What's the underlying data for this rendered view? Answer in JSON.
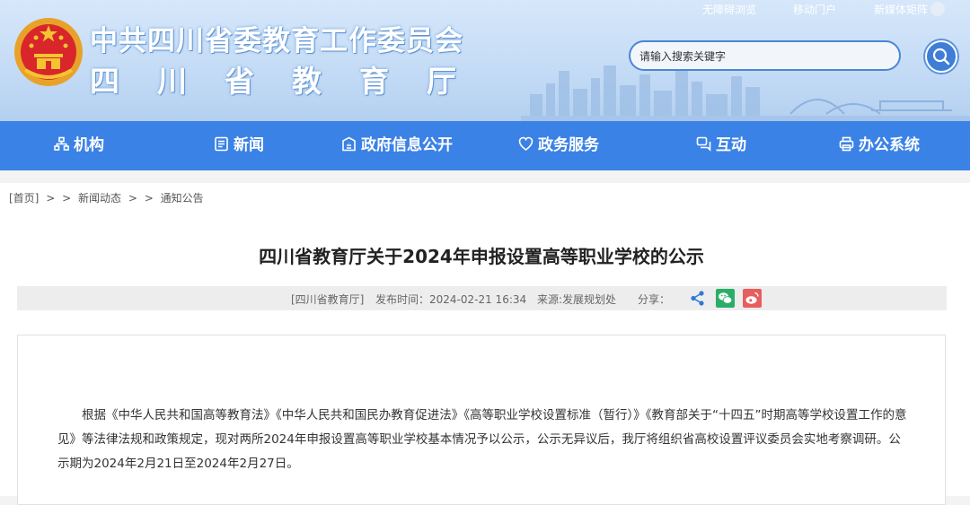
{
  "header": {
    "title_main": "中共四川省委教育工作委员会",
    "title_sub": "四川省教育厅",
    "top_links": [
      "无障碍浏览",
      "移动门户",
      "新媒体矩阵"
    ],
    "search_placeholder": "请输入搜索关键字"
  },
  "nav": {
    "items": [
      {
        "label": "机构",
        "icon": "org-icon"
      },
      {
        "label": "新闻",
        "icon": "news-icon"
      },
      {
        "label": "政府信息公开",
        "icon": "info-icon"
      },
      {
        "label": "政务服务",
        "icon": "service-icon"
      },
      {
        "label": "互动",
        "icon": "chat-icon"
      },
      {
        "label": "办公系统",
        "icon": "printer-icon"
      }
    ]
  },
  "breadcrumb": [
    "[首页]",
    ">",
    ">",
    "新闻动态",
    ">",
    ">",
    "通知公告"
  ],
  "article": {
    "title": "四川省教育厅关于2024年申报设置高等职业学校的公示",
    "meta": {
      "source_tag": "[四川省教育厅]",
      "publish_time": "发布时间：2024-02-21 16:34",
      "origin": "来源:发展规划处",
      "share_label": "分享："
    },
    "paragraph": "根据《中华人民共和国高等教育法》《中华人民共和国民办教育促进法》《高等职业学校设置标准（暂行）》《教育部关于“十四五”时期高等学校设置工作的意见》等法律法规和政策规定，现对两所2024年申报设置高等职业学校基本情况予以公示，公示无异议后，我厅将组织省高校设置评议委员会实地考察调研。公示期为2024年2月21日至2024年2月27日。"
  },
  "colors": {
    "nav_bg": "#3b82e6",
    "wechat": "#2aae67",
    "weibo": "#e6162d",
    "share": "#2d7ad6"
  }
}
